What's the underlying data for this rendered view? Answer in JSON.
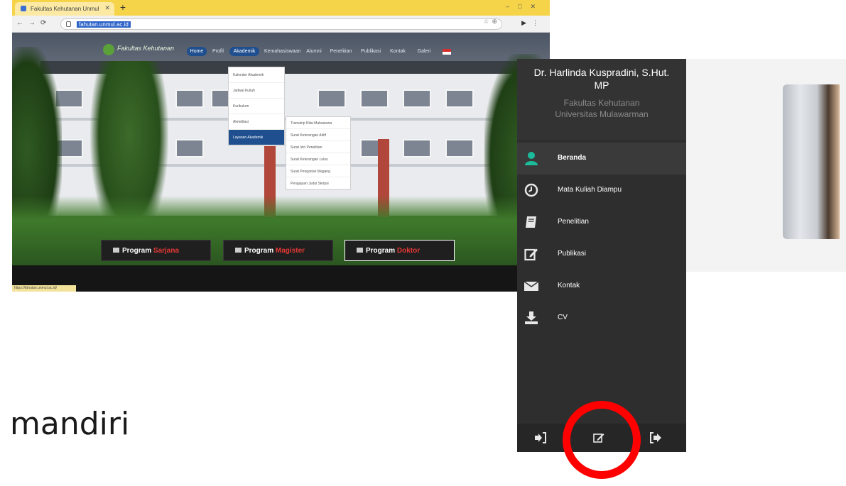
{
  "caption": "mandiri",
  "colors": {
    "annotation": "#ff0000",
    "sidebar_bg": "#2e2e2e",
    "active_icon": "#1abc9c",
    "nav_active": "#1f4f8f",
    "program_highlight": "#e53935"
  },
  "browser": {
    "tab_title": "Fakultas Kehutanan Unmul",
    "url": "fahutan.unmul.ac.id"
  },
  "site": {
    "logo_text": "Fakultas Kehutanan",
    "nav": [
      "Home",
      "Profil",
      "Akademik",
      "Kemahasiswaan",
      "Alumni",
      "Penelitian",
      "Publikasi",
      "Kontak",
      "Galeri"
    ],
    "dropdown": [
      "Kalender Akademik",
      "Jadwal Kuliah",
      "Kurikulum",
      "Akreditasi",
      "Layanan Akademik"
    ],
    "subdropdown": [
      "Transkrip Nilai Mahasiswa",
      "Surat Keterangan Aktif",
      "Surat Izin Penelitian",
      "Surat Keterangan Lulus",
      "Surat Pengantar Magang",
      "Pengajuan Judul Skripsi"
    ],
    "programs": [
      {
        "prefix": "Program",
        "name": "Sarjana"
      },
      {
        "prefix": "Program",
        "name": "Magister"
      },
      {
        "prefix": "Program",
        "name": "Doktor"
      }
    ],
    "status_url": "https://fahutan.unmul.ac.id/"
  },
  "profile": {
    "name": "Dr. Harlinda Kuspradini, S.Hut. MP",
    "faculty": "Fakultas Kehutanan",
    "university": "Universitas Mulawarman",
    "menu": [
      {
        "label": "Beranda",
        "icon": "user-icon",
        "active": true
      },
      {
        "label": "Mata Kuliah Diampu",
        "icon": "clock-icon",
        "active": false
      },
      {
        "label": "Penelitian",
        "icon": "book-icon",
        "active": false
      },
      {
        "label": "Publikasi",
        "icon": "edit-icon",
        "active": false
      },
      {
        "label": "Kontak",
        "icon": "envelope-icon",
        "active": false
      },
      {
        "label": "CV",
        "icon": "download-icon",
        "active": false
      }
    ],
    "footer_icons": [
      "sign-in-icon",
      "edit-icon",
      "sign-out-icon"
    ]
  }
}
